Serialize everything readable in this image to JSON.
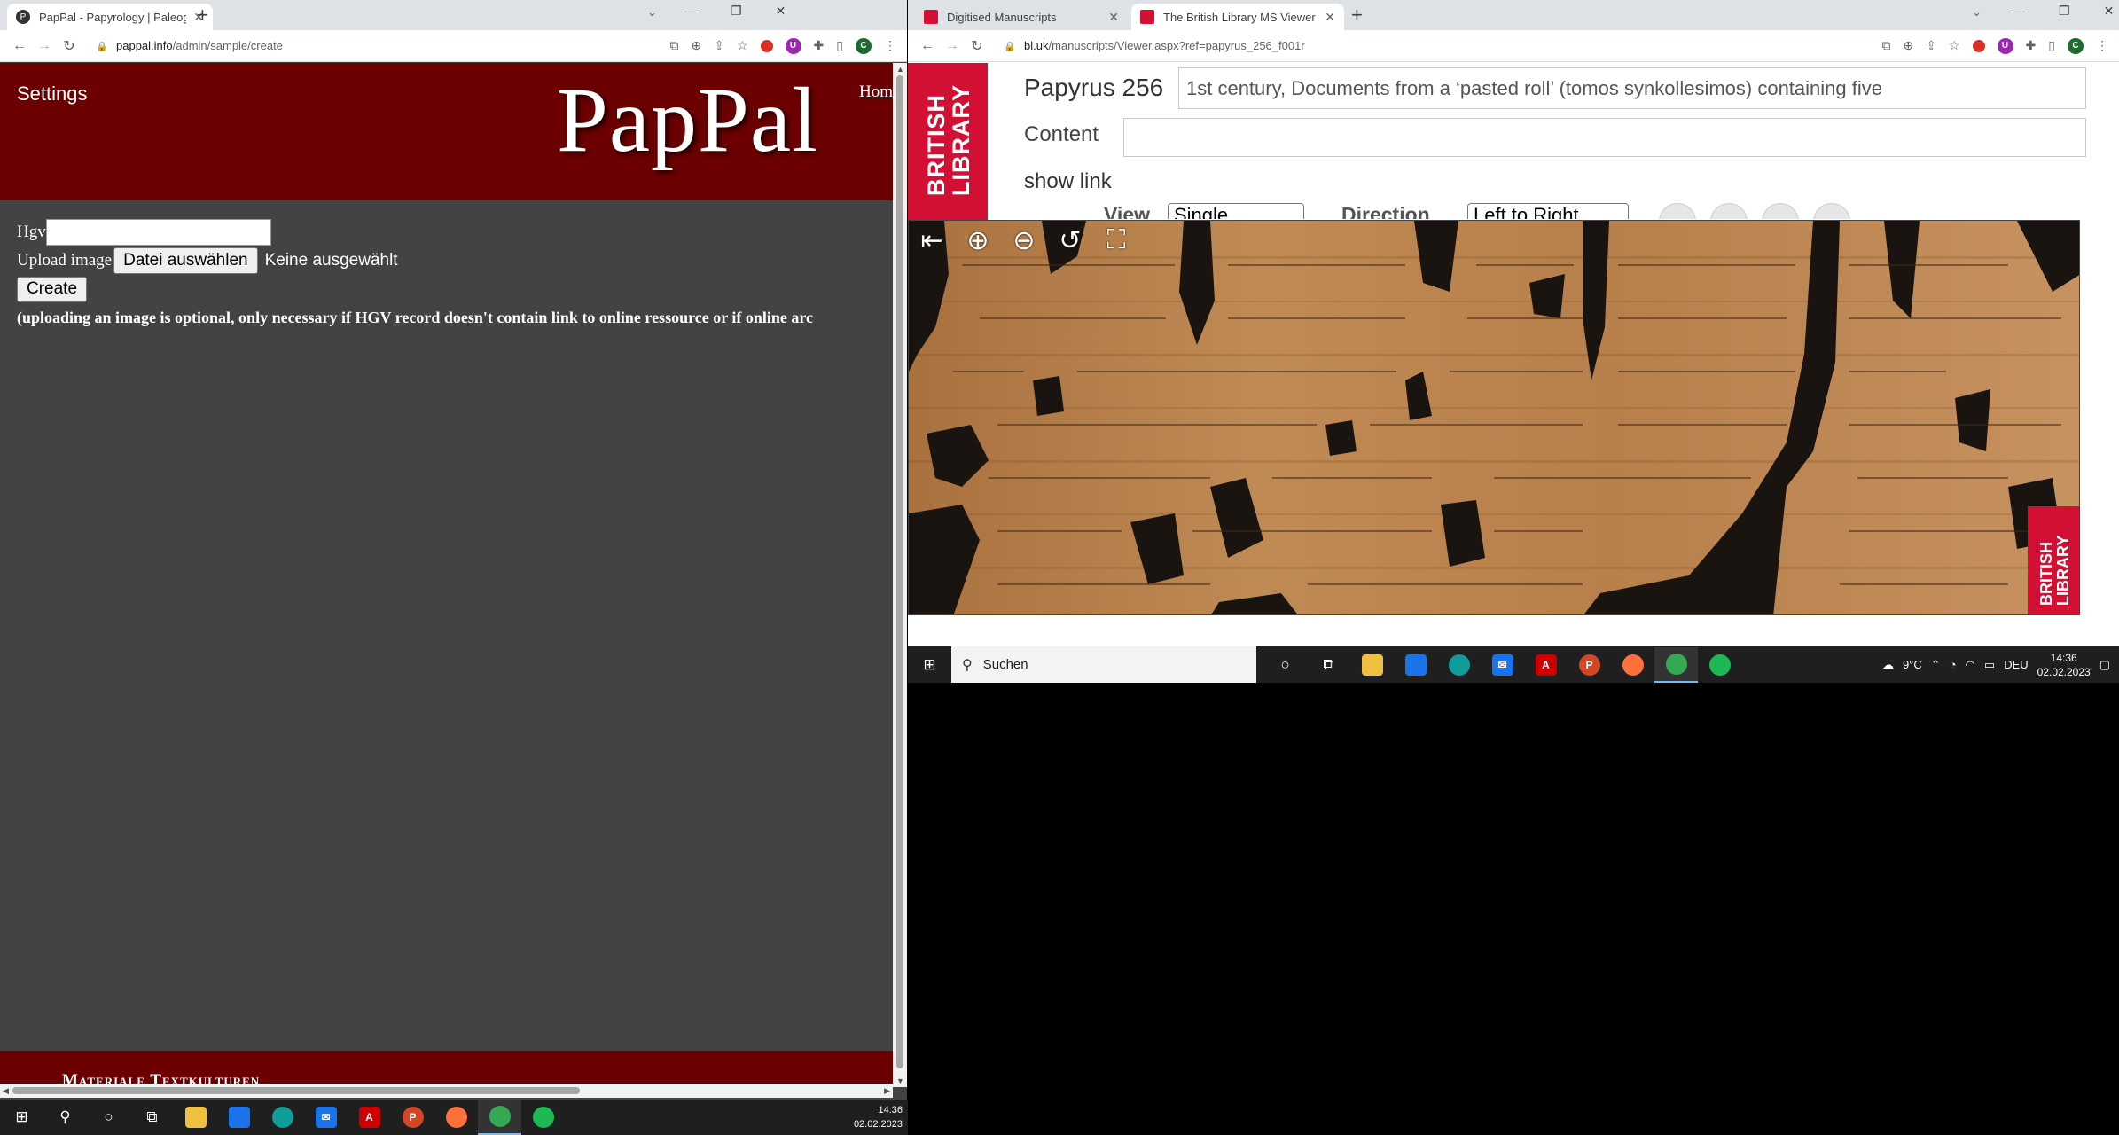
{
  "left_window": {
    "tab": {
      "title": "PapPal - Papyrology | Paleograph",
      "favicon_color": "#333333"
    },
    "url": {
      "host": "pappal.info",
      "path": "/admin/sample/create"
    },
    "page": {
      "settings_label": "Settings",
      "logo_text": "PapPal",
      "home_link": "Hom",
      "hgv_label": "Hgv",
      "hgv_value": "",
      "upload_label": "Upload image",
      "file_button": "Datei auswählen",
      "file_status": "Keine ausgewählt",
      "create_button": "Create",
      "note": "(uploading an image is optional, only necessary if HGV record doesn't contain link to online ressource or if online arc",
      "footer_text": "Materiale Textkulturen",
      "header_color": "#6c0000",
      "body_color": "#434343"
    },
    "taskbar": {
      "time": "14:36",
      "date": "02.02.2023"
    }
  },
  "right_window": {
    "tabs": [
      {
        "title": "Digitised Manuscripts",
        "active": false
      },
      {
        "title": "The British Library MS Viewer",
        "active": true
      }
    ],
    "url": {
      "host": "bl.uk",
      "path": "/manuscripts/Viewer.aspx?ref=papyrus_256_f001r"
    },
    "page": {
      "logo_text": "BRITISH\nLIBRARY",
      "ms_title": "Papyrus 256",
      "description": "1st century, Documents from a ‘pasted roll’ (tomos synkollesimos) containing five",
      "content_label": "Content",
      "content_value": "",
      "show_link": "show link",
      "view_label": "View",
      "view_value": "Single",
      "direction_label": "Direction",
      "direction_value": "Left to Right",
      "watermark_text": "BRITISH\nLIBRARY",
      "brand_color": "#d21034"
    },
    "taskbar": {
      "search_placeholder": "Suchen",
      "weather": "9°C",
      "language": "DEU",
      "time": "14:36",
      "date": "02.02.2023"
    }
  }
}
